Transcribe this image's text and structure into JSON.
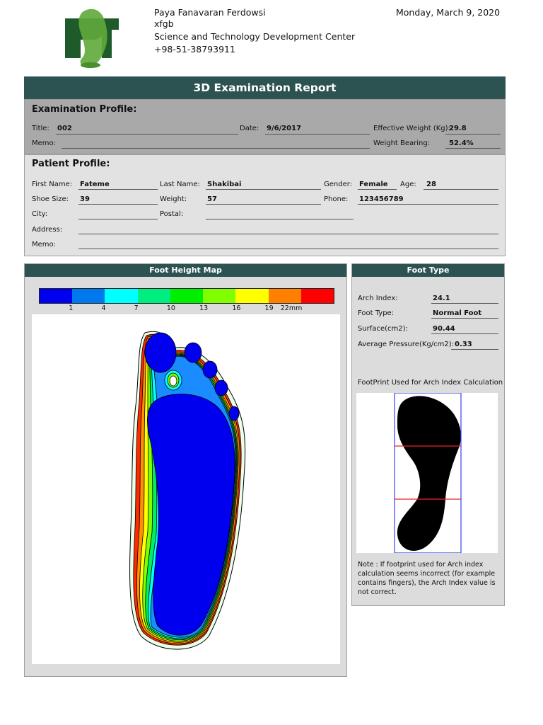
{
  "header": {
    "lines": [
      "Paya Fanavaran Ferdowsi",
      "xfgb",
      "Science and Technology Development Center",
      "+98-51-38793911"
    ],
    "date": "Monday, March 9, 2020"
  },
  "report_title": "3D Examination Report",
  "exam_profile": {
    "heading": "Examination Profile:",
    "title_label": "Title:",
    "title_value": "002",
    "date_label": "Date:",
    "date_value": "9/6/2017",
    "eff_weight_label": "Effective Weight (Kg):",
    "eff_weight_value": "29.8",
    "memo_label": "Memo:",
    "weight_bearing_label": "Weight Bearing:",
    "weight_bearing_value": "52.4%"
  },
  "patient_profile": {
    "heading": "Patient Profile:",
    "first_name_label": "First Name:",
    "first_name_value": "Fateme",
    "last_name_label": "Last Name:",
    "last_name_value": "Shakibai",
    "gender_label": "Gender:",
    "gender_value": "Female",
    "age_label": "Age:",
    "age_value": "28",
    "shoe_size_label": "Shoe Size:",
    "shoe_size_value": "39",
    "weight_label": "Weight:",
    "weight_value": "57",
    "phone_label": "Phone:",
    "phone_value": "123456789",
    "city_label": "City:",
    "postal_label": "Postal:",
    "address_label": "Address:",
    "memo_label": "Memo:"
  },
  "foot_height_map": {
    "title": "Foot Height Map",
    "scale_colors": [
      "#0000ee",
      "#0078ee",
      "#00ffff",
      "#00ee80",
      "#00ee00",
      "#80ff00",
      "#ffff00",
      "#ff8000",
      "#ff0000"
    ],
    "scale_labels": [
      "1",
      "4",
      "7",
      "10",
      "13",
      "16",
      "19",
      "22mm"
    ]
  },
  "foot_type": {
    "title": "Foot Type",
    "arch_index_label": "Arch Index:",
    "arch_index_value": "24.1",
    "foot_type_label": "Foot Type:",
    "foot_type_value": "Normal Foot",
    "surface_label": "Surface(cm2):",
    "surface_value": "90.44",
    "avg_pressure_label": "Average Pressure(Kg/cm2):",
    "avg_pressure_value": "0.33",
    "footprint_caption": "FootPrint Used for Arch Index Calculation",
    "note": "Note : If footprint used for Arch index calculation seems incorrect (for example contains fingers), the Arch Index value is not correct."
  }
}
